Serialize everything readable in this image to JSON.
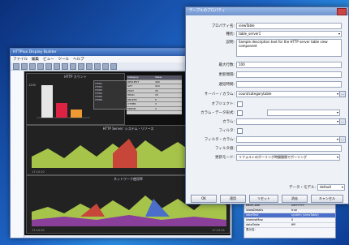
{
  "app": {
    "title": "HTTPlux Display Builder",
    "menu": [
      "ファイル",
      "編集",
      "ビュー",
      "ツール",
      "ヘルプ"
    ]
  },
  "dashboard": {
    "panel1_title": "HTTP カウント",
    "panel2_title": "HTTP Server: システム・リソース",
    "panel3_title": "ネットワーク使用率",
    "time_labels": [
      "17:10:10",
      "17:10:30",
      "17:12:51"
    ],
    "legend_items": [
      "ITEM1",
      "ITEM2",
      "ITEM3",
      "ITEM4",
      "ITEM5",
      "ITEM6"
    ],
    "table_header": [
      "Category",
      "Value"
    ],
    "table_rows": [
      [
        "REQUEST",
        "460"
      ],
      [
        "GET",
        "410"
      ],
      [
        "POST",
        "35"
      ],
      [
        "HEAD",
        "15"
      ],
      [
        "DELETE",
        "5"
      ],
      [
        "OTHER",
        "3"
      ],
      [
        "ERROR",
        "2"
      ]
    ],
    "y_max": "1200"
  },
  "dialog": {
    "title": "テーブルのプロパティ",
    "labels": {
      "property": "プロパティ名:",
      "type": "種別:",
      "description": "説明:",
      "max_rows": "最大行数:",
      "interval": "更新間隔:",
      "delay": "遅延時間:",
      "server": "サーバー / カラム:",
      "object": "オブジェクト:",
      "data_type": "カラム・データ形式:",
      "column": "カラム:",
      "filter": "フィルタ:",
      "filter_column": "フィルタ・カラム:",
      "filter_value": "フィルタ値:",
      "update_mode": "更新モード:",
      "data_model": "データ・モデル:"
    },
    "values": {
      "property": "viewTable",
      "type": "table_server1",
      "description": "Sample description text for the HTTP server table view component",
      "max_rows": "100",
      "interval": "",
      "delay": "",
      "server": "count/categorytable",
      "update_mode": "リフォルトのポーリング時間間隔でポーリング",
      "data_model": "default"
    },
    "buttons": [
      "OK",
      "適用",
      "リセット",
      "消去",
      "キャンセル"
    ]
  },
  "subpanel": {
    "rows": [
      [
        "backColor",
        "0xFFFFFF"
      ],
      [
        "showDetails",
        "true"
      ],
      [
        "labelText",
        "system (viewTable)"
      ],
      [
        "shadowMap",
        "0"
      ],
      [
        "dataTable",
        "ffff"
      ]
    ],
    "footer": "表示名:"
  },
  "colors": {
    "accent": "#2f5fae",
    "chart_green": "#a7c44a",
    "chart_blue": "#4a6ec9",
    "chart_red": "#c8453a"
  }
}
